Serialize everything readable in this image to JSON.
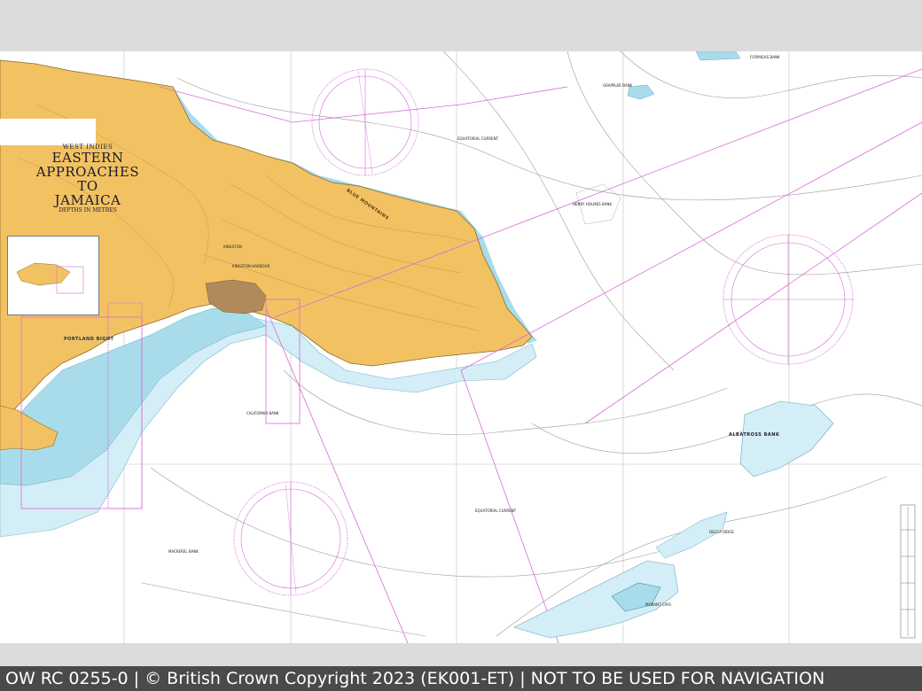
{
  "title": {
    "region": "WEST INDIES",
    "line1": "EASTERN APPROACHES",
    "line2": "TO",
    "line3": "JAMAICA",
    "depths": "DEPTHS IN METRES"
  },
  "labels": {
    "blue_mountains": "BLUE MOUNTAINS",
    "kingston": "KINGSTON",
    "kingston_harbour": "KINGSTON HARBOUR",
    "portland_bight": "PORTLAND BIGHT",
    "grappler_bank": "GRAPPLER BANK",
    "henry_holmes_bank": "HENRY HOLMES BANK",
    "albatross_bank": "ALBATROSS BANK",
    "decca_ridge": "DECCA RIDGE",
    "morant_cays": "MORANT CAYS",
    "mackerel_bank": "MACKEREL BANK",
    "california_bank": "CALIFORNIA BANK",
    "formigas_bank": "FORMIGAS BANK",
    "equatorial_current_1": "EQUATORIAL CURRENT",
    "equatorial_current_2": "EQUATORIAL CURRENT"
  },
  "colors": {
    "land": "#f2c262",
    "shallow": "#a9dceb",
    "deep_shallow": "#d3eef6",
    "sea": "#ffffff",
    "magenta": "#d86ad8"
  },
  "footer": {
    "text": "OW RC 0255-0 | © British Crown Copyright 2023 (EK001-ET) | NOT TO BE USED FOR NAVIGATION"
  }
}
